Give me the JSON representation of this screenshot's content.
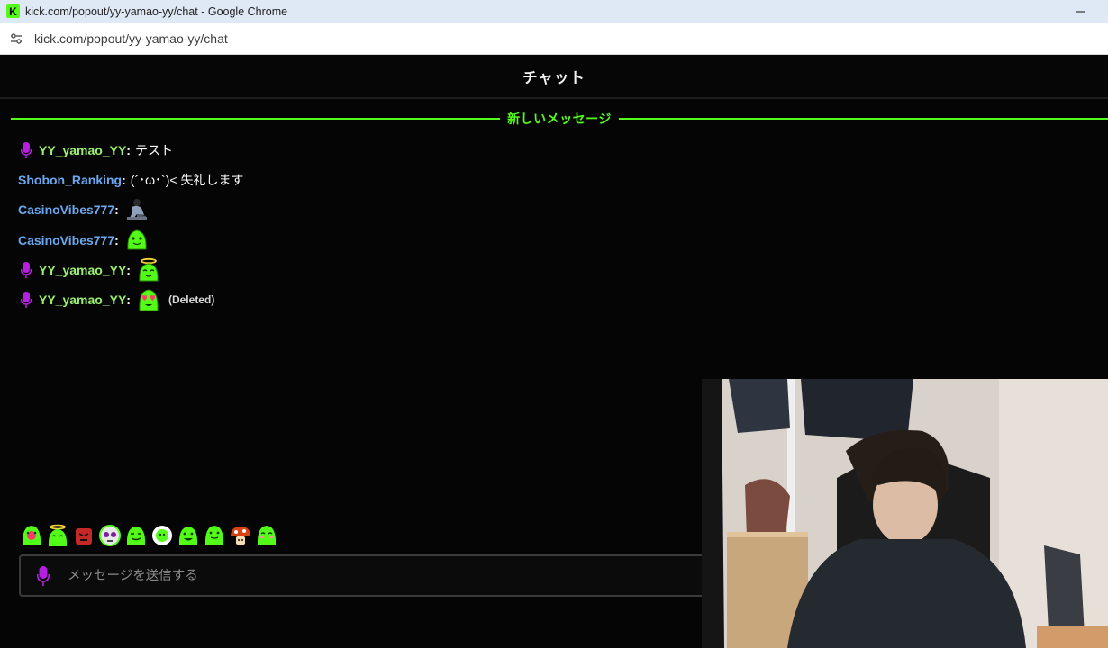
{
  "window": {
    "title": "kick.com/popout/yy-yamao-yy/chat - Google Chrome",
    "favicon_letter": "K",
    "url": "kick.com/popout/yy-yamao-yy/chat"
  },
  "chat": {
    "header": "チャット",
    "new_messages_divider": "新しいメッセージ",
    "messages": [
      {
        "badge": "microphone-badge-icon",
        "user": "YY_yamao_YY",
        "user_color": "#9af16b",
        "text": "テスト"
      },
      {
        "badge": null,
        "user": "Shobon_Ranking",
        "user_color": "#6aa8f0",
        "text": "(´･ω･`)< 失礼します"
      },
      {
        "badge": null,
        "user": "CasinoVibes777",
        "user_color": "#6aa8f0",
        "emote": "sitting-man-emote"
      },
      {
        "badge": null,
        "user": "CasinoVibes777",
        "user_color": "#6aa8f0",
        "emote": "green-blob-emote"
      },
      {
        "badge": "microphone-badge-icon",
        "user": "YY_yamao_YY",
        "user_color": "#9af16b",
        "emote": "angel-blob-emote"
      },
      {
        "badge": "microphone-badge-icon",
        "user": "YY_yamao_YY",
        "user_color": "#9af16b",
        "emote": "heart-eyes-blob-emote",
        "status": "(Deleted)"
      }
    ],
    "emote_bar": [
      "heart-blob-emote",
      "angel-blob-emote",
      "angry-box-emote",
      "skull-emote",
      "smile-blob-emote",
      "flower-emote",
      "happy-blob-emote",
      "wave-blob-emote",
      "mushroom-emote",
      "shy-blob-emote"
    ],
    "input_placeholder": "メッセージを送信する"
  },
  "colors": {
    "accent": "#53fc18",
    "badge": "#b620e0",
    "background": "#050505"
  }
}
